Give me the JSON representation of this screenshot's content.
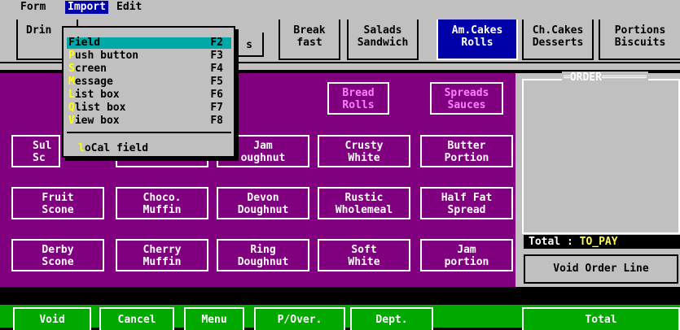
{
  "menubar": {
    "items": [
      {
        "label": "Form",
        "active": false
      },
      {
        "label": "Import",
        "active": true
      },
      {
        "label": "Edit",
        "active": false
      }
    ]
  },
  "topbar": {
    "buttons": [
      {
        "label": "Drin",
        "selected": false
      },
      {
        "label": "s",
        "selected": false
      },
      {
        "label": "Break\nfast",
        "selected": false
      },
      {
        "label": "Salads\nSandwich",
        "selected": false
      },
      {
        "label": "Am.Cakes\nRolls",
        "selected": true
      },
      {
        "label": "Ch.Cakes\nDesserts",
        "selected": false
      },
      {
        "label": "Portions\nBiscuits",
        "selected": false
      }
    ]
  },
  "dropdown": {
    "items": [
      {
        "label": "Field",
        "key": "F2",
        "active": true
      },
      {
        "label": "Push button",
        "key": "F3",
        "active": false
      },
      {
        "label": "Screen",
        "key": "F4",
        "active": false
      },
      {
        "label": "Message",
        "key": "F5",
        "active": false
      },
      {
        "label": "List box",
        "key": "F6",
        "active": false
      },
      {
        "label": "Qlist box",
        "key": "F7",
        "active": false
      },
      {
        "label": "View box",
        "key": "F8",
        "active": false
      }
    ],
    "local_field": "loCal field"
  },
  "panel": {
    "top_buttons": [
      {
        "label": "Bread\nRolls"
      },
      {
        "label": "Spreads\nSauces"
      }
    ],
    "rows": [
      [
        {
          "label": "Sul\nSc"
        },
        {
          "label": ""
        },
        {
          "label": "Jam\noughnut"
        },
        {
          "label": "Crusty\nWhite"
        },
        {
          "label": "Butter\nPortion"
        }
      ],
      [
        {
          "label": "Fruit\nScone"
        },
        {
          "label": "Choco.\nMuffin"
        },
        {
          "label": "Devon\nDoughnut"
        },
        {
          "label": "Rustic\nWholemeal"
        },
        {
          "label": "Half Fat\nSpread"
        }
      ],
      [
        {
          "label": "Derby\nScone"
        },
        {
          "label": "Cherry\nMuffin"
        },
        {
          "label": "Ring\nDoughnut"
        },
        {
          "label": "Soft\nWhite"
        },
        {
          "label": "Jam\nportion"
        }
      ]
    ]
  },
  "order": {
    "title": "ORDER",
    "total_label": "Total : ",
    "total_value": "TO_PAY",
    "void_order_line": "Void Order Line"
  },
  "bottom": {
    "buttons": [
      "Void",
      "Cancel",
      "Menu",
      "P/Over.",
      "Dept."
    ],
    "total_label": "Total"
  },
  "colors": {
    "panel_purple": "#80007f",
    "menu_gray": "#c0c0c0",
    "selected_blue": "#0000a8",
    "bottom_green": "#00a800",
    "highlight_teal": "#00a8a8",
    "hotkey_yellow": "#ffff00"
  }
}
